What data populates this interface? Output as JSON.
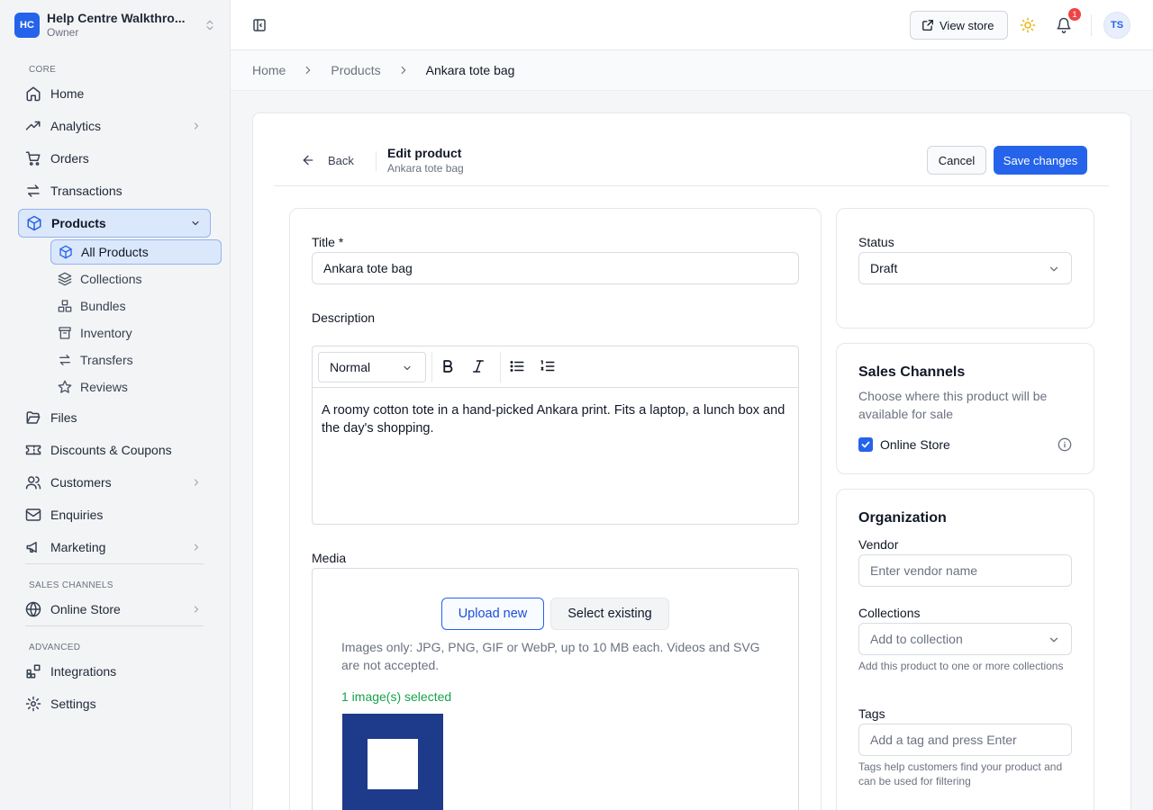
{
  "workspace": {
    "badge": "HC",
    "name": "Help Centre Walkthro...",
    "role": "Owner"
  },
  "sidebar": {
    "core_label": "CORE",
    "items": [
      {
        "label": "Home"
      },
      {
        "label": "Analytics"
      },
      {
        "label": "Orders"
      },
      {
        "label": "Transactions"
      },
      {
        "label": "Products"
      },
      {
        "label": "Files"
      },
      {
        "label": "Discounts & Coupons"
      },
      {
        "label": "Customers"
      },
      {
        "label": "Enquiries"
      },
      {
        "label": "Marketing"
      }
    ],
    "products_sub": [
      {
        "label": "All Products"
      },
      {
        "label": "Collections"
      },
      {
        "label": "Bundles"
      },
      {
        "label": "Inventory"
      },
      {
        "label": "Transfers"
      },
      {
        "label": "Reviews"
      }
    ],
    "sales_label": "SALES CHANNELS",
    "online_store": "Online Store",
    "advanced_label": "ADVANCED",
    "integrations": "Integrations",
    "settings": "Settings"
  },
  "topbar": {
    "view_store": "View store",
    "notifications": "1",
    "avatar": "TS"
  },
  "breadcrumb": [
    "Home",
    "Products",
    "Ankara tote bag"
  ],
  "header": {
    "back": "Back",
    "title": "Edit product",
    "subtitle": "Ankara tote bag",
    "cancel": "Cancel",
    "save": "Save changes"
  },
  "form": {
    "title_label": "Title *",
    "title_value": "Ankara tote bag",
    "description_label": "Description",
    "format": "Normal",
    "description_text": "A roomy cotton tote in a hand-picked Ankara print. Fits a laptop, a lunch box and the day's shopping.",
    "media_label": "Media",
    "upload_new": "Upload new",
    "select_existing": "Select existing",
    "media_hint": "Images only: JPG, PNG, GIF or WebP, up to 10 MB each. Videos and SVG are not accepted.",
    "media_count": "1 image(s) selected"
  },
  "status": {
    "label": "Status",
    "value": "Draft"
  },
  "sales_channels": {
    "title": "Sales Channels",
    "desc": "Choose where this product will be available for sale",
    "channel": "Online Store"
  },
  "organization": {
    "title": "Organization",
    "vendor_label": "Vendor",
    "vendor_placeholder": "Enter vendor name",
    "collections_label": "Collections",
    "collections_placeholder": "Add to collection",
    "collections_help": "Add this product to one or more collections",
    "tags_label": "Tags",
    "tags_placeholder": "Add a tag and press Enter",
    "tags_help": "Tags help customers find your product and can be used for filtering"
  },
  "colors": {
    "accent": "#2563eb",
    "thumb": "#1e3a8a",
    "success": "#16a34a",
    "badge": "#ef4444"
  }
}
